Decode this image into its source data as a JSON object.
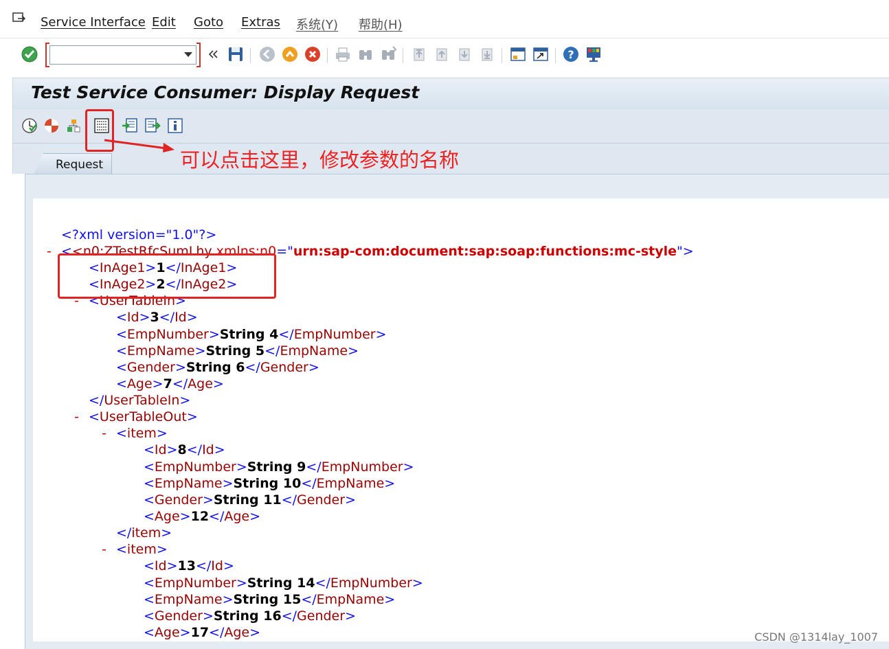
{
  "menu": {
    "items": [
      "Service Interface",
      "Edit",
      "Goto",
      "Extras",
      "系统(Y)",
      "帮助(H)"
    ]
  },
  "toolbar": {
    "command_value": "",
    "icons": [
      "enter-icon",
      "save-icon",
      "back-icon",
      "exit-icon",
      "cancel-icon",
      "print-icon",
      "find-icon",
      "find-next-icon",
      "first-page-icon",
      "previous-page-icon",
      "next-page-icon",
      "last-page-icon",
      "create-session-icon",
      "create-shortcut-icon",
      "help-icon",
      "customize-layout-icon"
    ]
  },
  "title": "Test Service Consumer: Display Request",
  "tabs": [
    "Request"
  ],
  "annotation": {
    "text": "可以点击这里，修改参数的名称",
    "color": "#ee2222"
  },
  "xml": {
    "decl": "<?xml version=\"1.0\"?>",
    "root_tag": "<n0:ZTestRfcSumLhy",
    "ns_attr": "xmlns:n0",
    "ns_value": "urn:sap-com:document:sap:soap:functions:mc-style",
    "inage1": "1",
    "inage2": "2",
    "user_table_in": {
      "id": "3",
      "emp_number": "String 4",
      "emp_name": "String 5",
      "gender": "String 6",
      "age": "7"
    },
    "user_table_out": [
      {
        "id": "8",
        "emp_number": "String 9",
        "emp_name": "String 10",
        "gender": "String 11",
        "age": "12"
      },
      {
        "id": "13",
        "emp_number": "String 14",
        "emp_name": "String 15",
        "gender": "String 16",
        "age": "17"
      }
    ]
  },
  "watermark": "CSDN @1314lay_1007",
  "colors": {
    "xml_bracket": "#1010ee",
    "xml_tag": "#990000",
    "xml_attr_value": "#cc0000",
    "annotation_red": "#e02424"
  }
}
